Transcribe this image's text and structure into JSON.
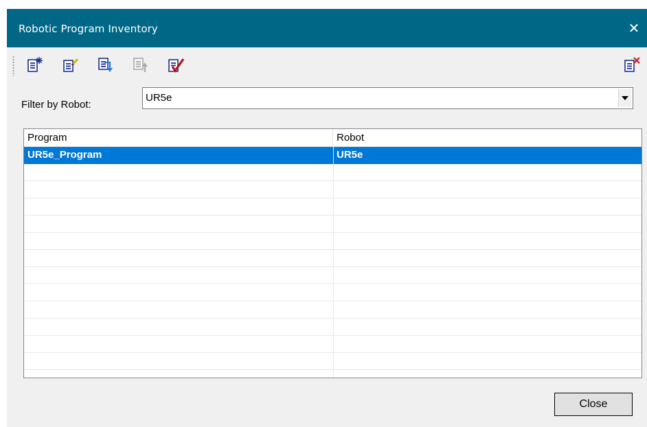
{
  "window": {
    "title": "Robotic Program Inventory",
    "close_glyph": "✕",
    "titlebar_color": "#006786"
  },
  "toolbar": {
    "icons": [
      "new-program-icon",
      "edit-program-icon",
      "import-program-icon",
      "export-program-icon",
      "check-program-icon",
      "delete-program-icon"
    ]
  },
  "filter": {
    "label": "Filter by Robot:",
    "value": "UR5e"
  },
  "table": {
    "columns": [
      "Program",
      "Robot"
    ],
    "rows": [
      {
        "program": "UR5e_Program",
        "robot": "UR5e",
        "selected": true
      }
    ],
    "selection_color": "#0078d7"
  },
  "footer": {
    "close_label": "Close"
  }
}
